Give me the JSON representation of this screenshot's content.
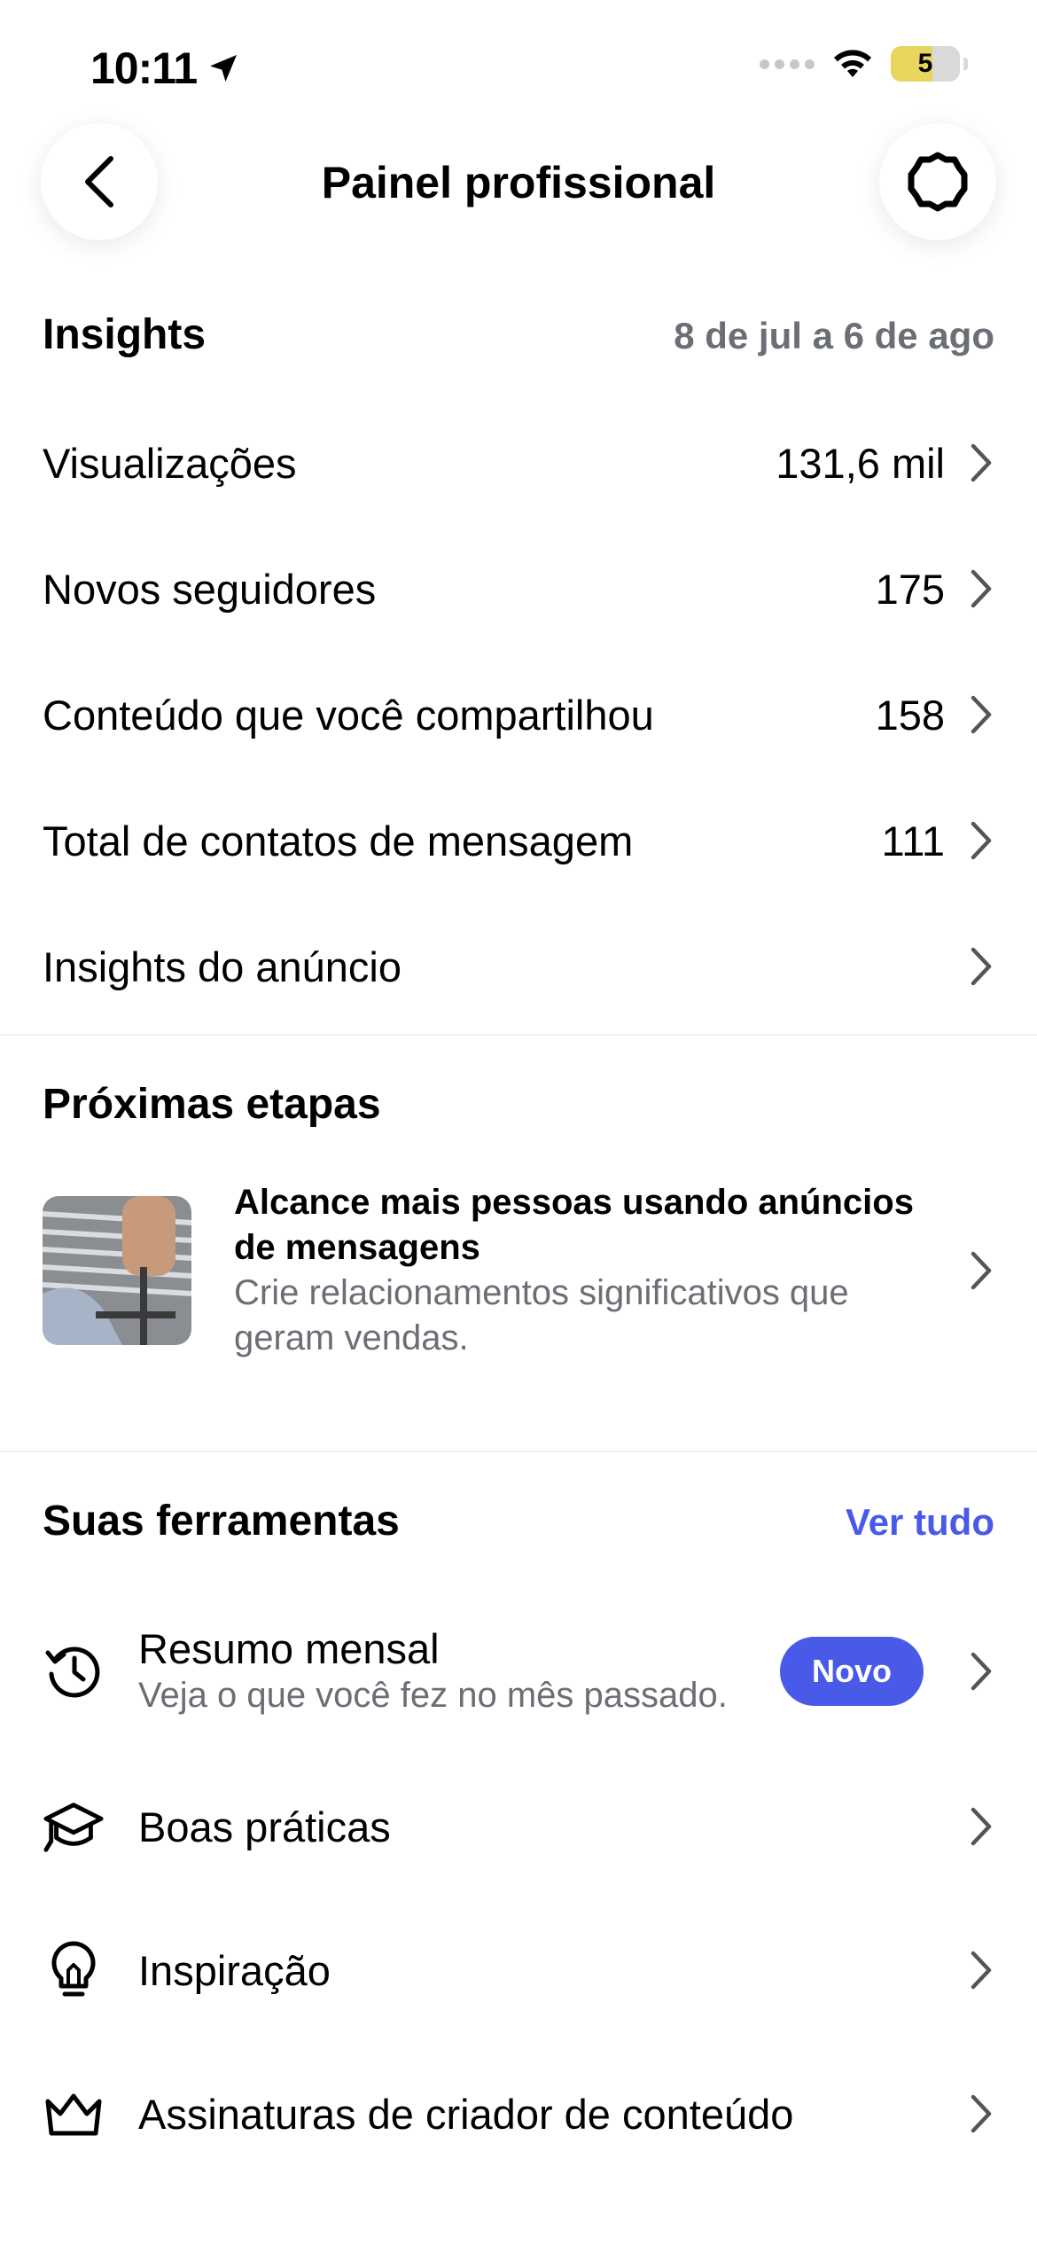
{
  "status_bar": {
    "time": "10:11",
    "battery": "5"
  },
  "header": {
    "title": "Painel profissional"
  },
  "insights": {
    "title": "Insights",
    "date_range": "8 de jul a 6 de ago",
    "rows": [
      {
        "label": "Visualizações",
        "value": "131,6 mil"
      },
      {
        "label": "Novos seguidores",
        "value": "175"
      },
      {
        "label": "Conteúdo que você compartilhou",
        "value": "158"
      },
      {
        "label": "Total de contatos de mensagem",
        "value": "111"
      },
      {
        "label": "Insights do anúncio",
        "value": ""
      }
    ]
  },
  "next_steps": {
    "title": "Próximas etapas",
    "card": {
      "title": "Alcance mais pessoas usando anúncios de mensagens",
      "subtitle": "Crie relacionamentos significativos que geram vendas."
    }
  },
  "tools": {
    "title": "Suas ferramentas",
    "see_all": "Ver tudo",
    "items": [
      {
        "label": "Resumo mensal",
        "subtitle": "Veja o que você fez no mês passado.",
        "badge": "Novo",
        "icon": "history-icon"
      },
      {
        "label": "Boas práticas",
        "icon": "graduation-cap-icon"
      },
      {
        "label": "Inspiração",
        "icon": "lightbulb-icon"
      },
      {
        "label": "Assinaturas de criador de conteúdo",
        "icon": "crown-icon"
      }
    ]
  },
  "colors": {
    "accent": "#4a5ae8",
    "secondary_text": "#6b6f75"
  }
}
